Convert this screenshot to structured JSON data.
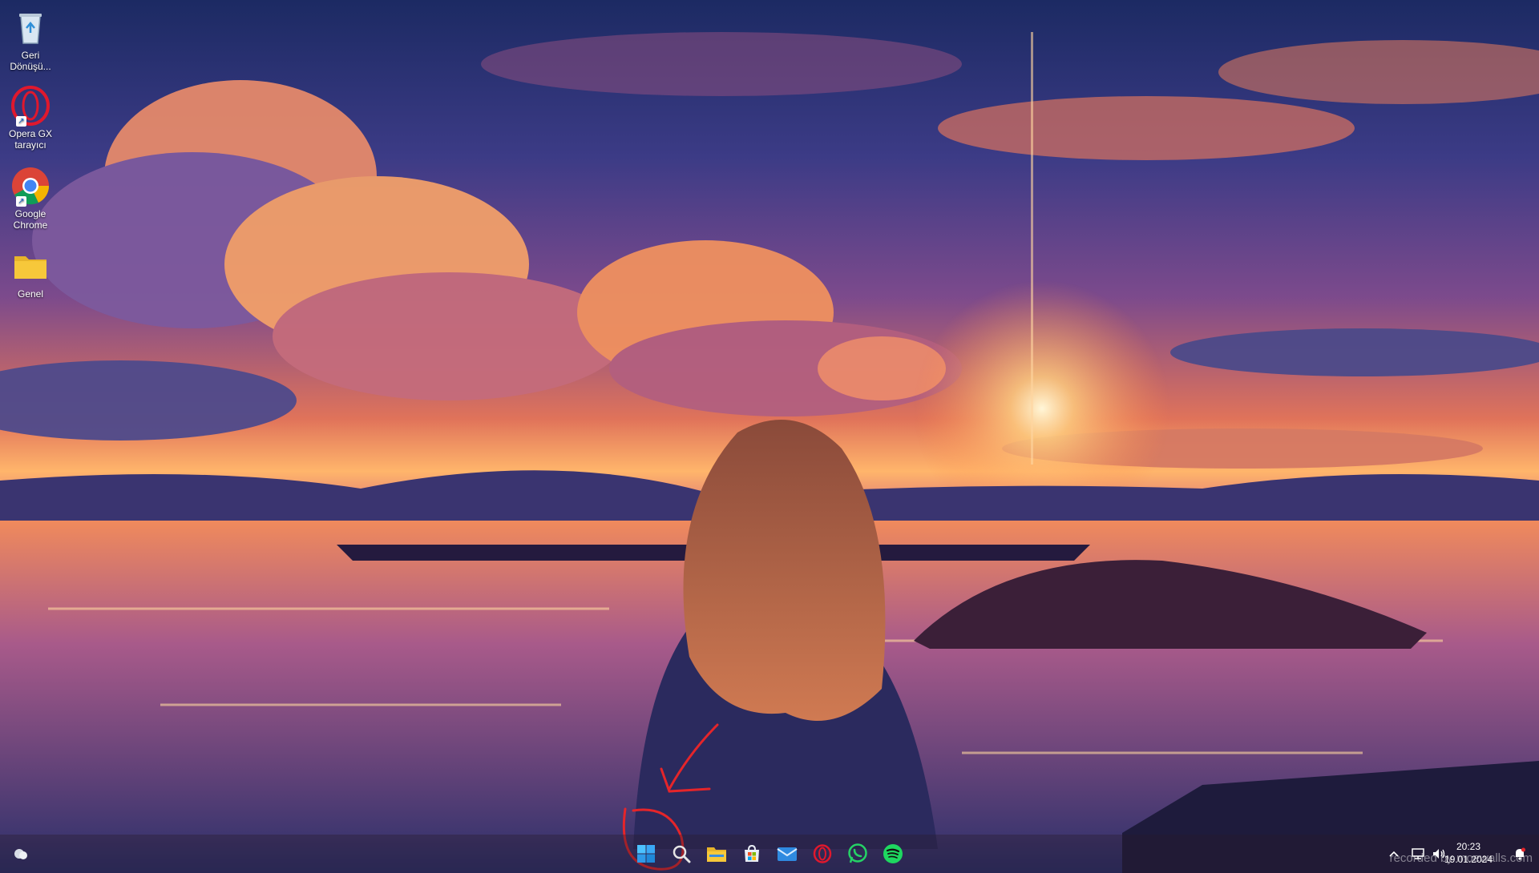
{
  "desktop": {
    "icons": [
      {
        "label": "Geri Dönüşü...",
        "icon": "recycle-bin-icon"
      },
      {
        "label": "Opera GX tarayıcı",
        "icon": "opera-gx-icon"
      },
      {
        "label": "Google Chrome",
        "icon": "chrome-icon"
      },
      {
        "label": "Genel",
        "icon": "folder-icon"
      }
    ]
  },
  "taskbar": {
    "apps": [
      "start-icon",
      "search-icon",
      "file-explorer-icon",
      "microsoft-store-icon",
      "mail-icon",
      "opera-gx-icon",
      "whatsapp-icon",
      "spotify-icon"
    ],
    "tray": {
      "time": "20:23",
      "date": "19.01.2024"
    }
  },
  "watermark": "recorded by moewalls.com",
  "colors": {
    "annotation": "#e5252a",
    "opera": "#e0182d",
    "whatsapp": "#25d366",
    "spotify": "#1ed760",
    "folder": "#f7c83a"
  }
}
